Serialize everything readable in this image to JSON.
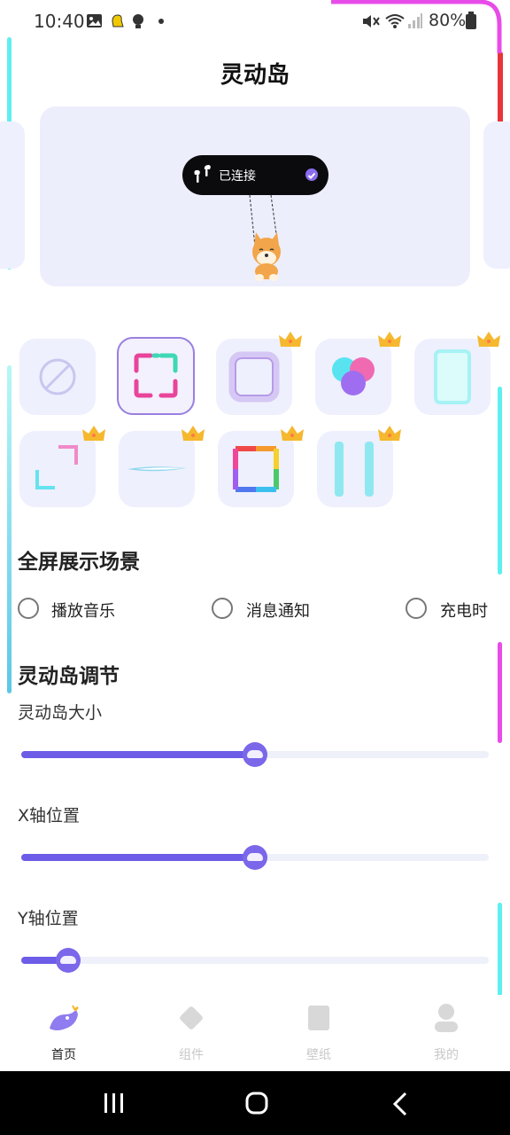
{
  "status_bar": {
    "time": "10:40",
    "battery": "80%"
  },
  "page": {
    "title": "灵动岛"
  },
  "island_preview": {
    "label": "已连接"
  },
  "styles": {
    "items": [
      {
        "name": "none",
        "premium": false,
        "selected": false
      },
      {
        "name": "dashed-square",
        "premium": false,
        "selected": true
      },
      {
        "name": "glow-square",
        "premium": true,
        "selected": false
      },
      {
        "name": "color-circles",
        "premium": true,
        "selected": false
      },
      {
        "name": "cyan-frame",
        "premium": true,
        "selected": false
      },
      {
        "name": "neon-corners",
        "premium": true,
        "selected": false
      },
      {
        "name": "light-beam",
        "premium": true,
        "selected": false
      },
      {
        "name": "rainbow-square",
        "premium": true,
        "selected": false
      },
      {
        "name": "twin-bars",
        "premium": true,
        "selected": false
      }
    ]
  },
  "fullscreen": {
    "title": "全屏展示场景",
    "options": [
      {
        "label": "播放音乐",
        "checked": false
      },
      {
        "label": "消息通知",
        "checked": false
      },
      {
        "label": "充电时",
        "checked": false
      }
    ]
  },
  "adjust": {
    "title": "灵动岛调节",
    "sliders": [
      {
        "label": "灵动岛大小",
        "value": 0.5
      },
      {
        "label": "X轴位置",
        "value": 0.5
      },
      {
        "label": "Y轴位置",
        "value": 0.1
      }
    ]
  },
  "bottom_nav": {
    "items": [
      {
        "label": "首页",
        "active": true
      },
      {
        "label": "组件",
        "active": false
      },
      {
        "label": "壁纸",
        "active": false
      },
      {
        "label": "我的",
        "active": false
      }
    ]
  },
  "colors": {
    "accent": "#6c5ce7",
    "neon_cyan": "#5ef0ee",
    "neon_pink": "#e84ce8",
    "neon_red": "#e8353a"
  }
}
